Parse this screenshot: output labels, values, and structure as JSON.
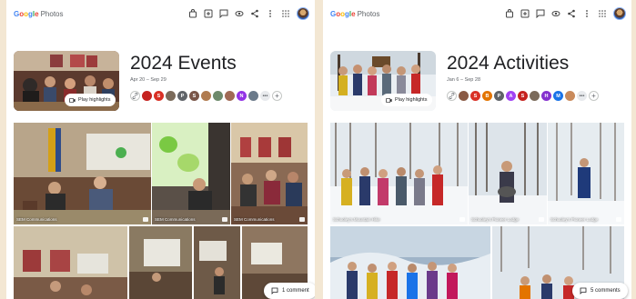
{
  "panels": [
    {
      "logo_word": "Google",
      "logo_product": "Photos",
      "album_title": "2024 Events",
      "date_range": "Apr 20 – Sep 29",
      "play_label": "Play highlights",
      "people": [
        {
          "initial": "",
          "color": "#c5221f"
        },
        {
          "initial": "S",
          "color": "#d93025"
        },
        {
          "initial": "",
          "color": "#7a6a5a"
        },
        {
          "initial": "P",
          "color": "#5f6368"
        },
        {
          "initial": "S",
          "color": "#795548"
        },
        {
          "initial": "",
          "color": "#b07b4f"
        },
        {
          "initial": "",
          "color": "#6d8a6b"
        },
        {
          "initial": "",
          "color": "#a06a55"
        },
        {
          "initial": "N",
          "color": "#9334e6"
        },
        {
          "initial": "",
          "color": "#6b7a8a"
        }
      ],
      "photo_captions": [
        "SEM Communications",
        "SEM Communications",
        "SEM Communications"
      ],
      "comment_label": "1 comment"
    },
    {
      "logo_word": "Google",
      "logo_product": "Photos",
      "album_title": "2024 Activities",
      "date_range": "Jan 6 – Sep 28",
      "play_label": "Play highlights",
      "people": [
        {
          "initial": "",
          "color": "#8a5a44"
        },
        {
          "initial": "S",
          "color": "#d93025"
        },
        {
          "initial": "B",
          "color": "#e37400"
        },
        {
          "initial": "P",
          "color": "#5f6368"
        },
        {
          "initial": "A",
          "color": "#a142f4"
        },
        {
          "initial": "S",
          "color": "#c5221f"
        },
        {
          "initial": "",
          "color": "#7a6a5a"
        },
        {
          "initial": "H",
          "color": "#8430ce"
        },
        {
          "initial": "M",
          "color": "#1a73e8"
        },
        {
          "initial": "",
          "color": "#c98a5b"
        }
      ],
      "photo_captions": [
        "Schooley's Mountain Hike",
        "Schooley's Pioneer Lodge",
        "Schooley's Pioneer Lodge"
      ],
      "comment_label": "5 comments"
    }
  ]
}
